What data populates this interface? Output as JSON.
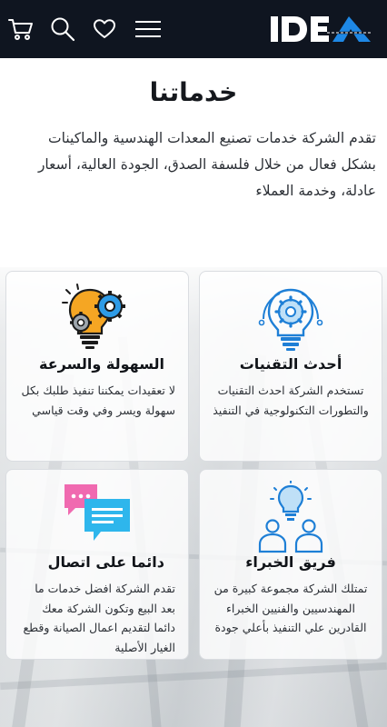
{
  "header": {
    "logo_text": "IDEA",
    "icons": [
      "menu-icon",
      "heart-icon",
      "search-icon",
      "cart-icon"
    ],
    "colors": {
      "bar": "#0f1520",
      "logo_accent": "#1e88e5"
    }
  },
  "intro": {
    "title": "خدماتنا",
    "text": "تقدم الشركة خدمات تصنيع المعدات الهندسية والماكينات بشكل فعال من خلال فلسفة الصدق، الجودة العالية، أسعار عادلة، وخدمة العملاء"
  },
  "services": [
    {
      "icon": "bulb-gear-icon",
      "title": "أحدث التقنيات",
      "description": "تستخدم الشركة احدث التقنيات والتطورات التكنولوجية في التنفيذ"
    },
    {
      "icon": "bulb-gears-icon",
      "title": "السهولة والسرعة",
      "description": "لا تعقيدات يمكننا تنفيذ طلبك بكل سهولة ويسر وفي وقت قياسي"
    },
    {
      "icon": "team-icon",
      "title": "فريق الخبراء",
      "description": "تمتلك الشركة مجموعة كبيرة من المهندسيين والفنيين الخبراء القادرين علي التنفيذ بأعلي جودة"
    },
    {
      "icon": "chat-bubbles-icon",
      "title": "دائما على اتصال",
      "description": "تقدم الشركة افضل خدمات ما بعد البيع وتكون الشركة معك دائما لتقديم اعمال الصيانة وقطع الغيار الأصلية"
    }
  ]
}
